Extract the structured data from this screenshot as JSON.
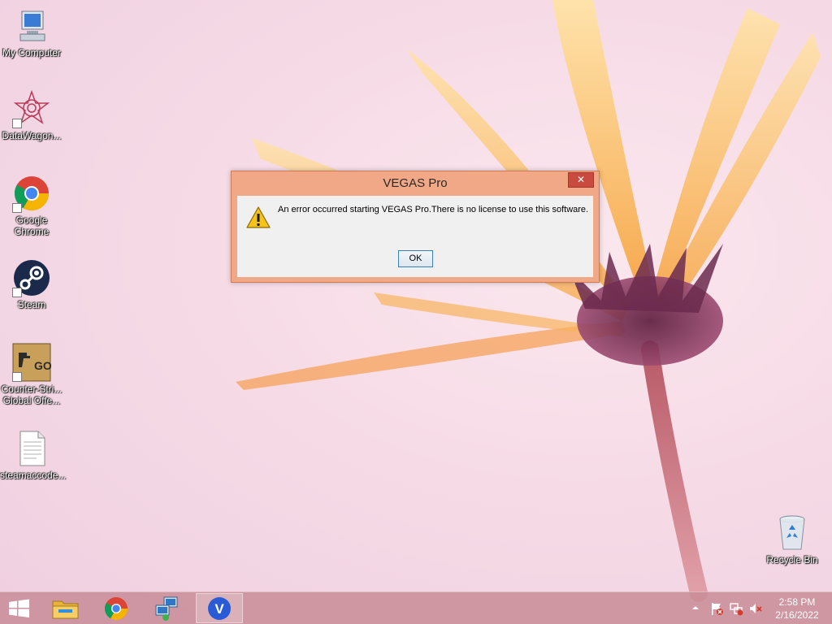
{
  "desktop": {
    "icons": [
      {
        "label": "My Computer",
        "icon": "computer-icon"
      },
      {
        "label": "DataWagon...",
        "icon": "datawagon-icon"
      },
      {
        "label": "Google\nChrome",
        "icon": "chrome-icon"
      },
      {
        "label": "Steam",
        "icon": "steam-icon"
      },
      {
        "label": "Counter-Stri...\nGlobal Offe...",
        "icon": "csgo-icon"
      },
      {
        "label": "steamaccode...",
        "icon": "text-file-icon"
      },
      {
        "label": "Recycle Bin",
        "icon": "recycle-bin-icon"
      }
    ],
    "csgo_badge": "GO"
  },
  "dialog": {
    "title": "VEGAS Pro",
    "close_glyph": "✕",
    "message": "An error occurred starting VEGAS Pro.There is no license to use this software.",
    "ok_label": "OK",
    "icon": "warning-icon"
  },
  "taskbar": {
    "start_icon": "windows-logo-icon",
    "pinned": [
      {
        "name": "file-explorer",
        "icon": "folder-icon"
      },
      {
        "name": "google-chrome",
        "icon": "chrome-icon"
      },
      {
        "name": "network",
        "icon": "network-connection-icon"
      },
      {
        "name": "vegas-pro",
        "icon": "vegas-pro-icon",
        "active": true,
        "glyph": "V"
      }
    ],
    "tray": {
      "icons": [
        "show-hidden-icons-chevron",
        "action-center-flag-icon",
        "network-icon",
        "volume-muted-icon"
      ],
      "time": "2:58 PM",
      "date": "2/16/2022"
    }
  },
  "colors": {
    "dialog_frame": "#f0a887",
    "close_button": "#c94a3e",
    "taskbar": "#c88c96",
    "vegas_blue": "#2a5bd7"
  }
}
